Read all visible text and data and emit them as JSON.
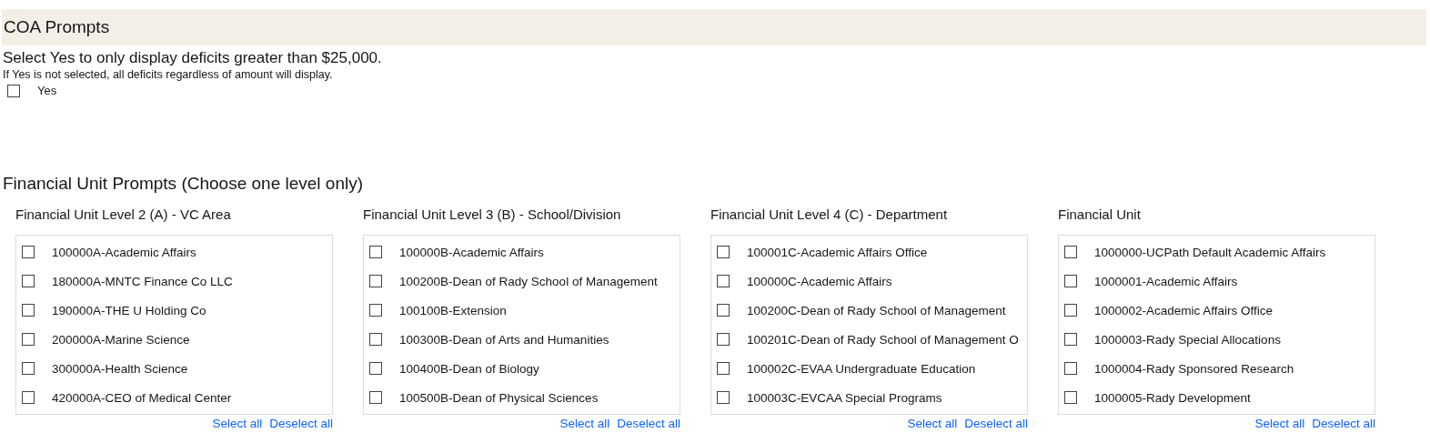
{
  "section_title": "COA Prompts",
  "deficit_prompt": {
    "heading": "Select Yes to only display deficits greater than $25,000.",
    "note": "If Yes is not selected, all deficits regardless of amount will display.",
    "option": {
      "label": "Yes",
      "checked": false
    }
  },
  "financial_unit_title": "Financial Unit Prompts (Choose one level only)",
  "lists": [
    {
      "label": "Financial Unit Level 2 (A) - VC Area",
      "items": [
        {
          "label": "100000A-Academic Affairs",
          "checked": false
        },
        {
          "label": "180000A-MNTC Finance Co LLC",
          "checked": false
        },
        {
          "label": "190000A-THE U Holding Co",
          "checked": false
        },
        {
          "label": "200000A-Marine Science",
          "checked": false
        },
        {
          "label": "300000A-Health Science",
          "checked": false
        },
        {
          "label": "420000A-CEO of Medical Center",
          "checked": false
        }
      ],
      "select_all": "Select all",
      "deselect_all": "Deselect all"
    },
    {
      "label": "Financial Unit Level 3 (B) - School/Division",
      "items": [
        {
          "label": "100000B-Academic Affairs",
          "checked": false
        },
        {
          "label": "100200B-Dean of Rady School of Management",
          "checked": false
        },
        {
          "label": "100100B-Extension",
          "checked": false
        },
        {
          "label": "100300B-Dean of Arts and Humanities",
          "checked": false
        },
        {
          "label": "100400B-Dean of Biology",
          "checked": false
        },
        {
          "label": "100500B-Dean of Physical Sciences",
          "checked": false
        }
      ],
      "select_all": "Select all",
      "deselect_all": "Deselect all"
    },
    {
      "label": "Financial Unit Level 4 (C) - Department",
      "items": [
        {
          "label": "100001C-Academic Affairs Office",
          "checked": false
        },
        {
          "label": "100000C-Academic Affairs",
          "checked": false
        },
        {
          "label": "100200C-Dean of Rady School of Management",
          "checked": false
        },
        {
          "label": "100201C-Dean of Rady School of Management O",
          "checked": false
        },
        {
          "label": "100002C-EVAA Undergraduate Education",
          "checked": false
        },
        {
          "label": "100003C-EVCAA Special Programs",
          "checked": false
        }
      ],
      "select_all": "Select all",
      "deselect_all": "Deselect all"
    },
    {
      "label": "Financial Unit",
      "items": [
        {
          "label": "1000000-UCPath Default Academic Affairs",
          "checked": false
        },
        {
          "label": "1000001-Academic Affairs",
          "checked": false
        },
        {
          "label": "1000002-Academic Affairs Office",
          "checked": false
        },
        {
          "label": "1000003-Rady Special Allocations",
          "checked": false
        },
        {
          "label": "1000004-Rady Sponsored Research",
          "checked": false
        },
        {
          "label": "1000005-Rady Development",
          "checked": false
        }
      ],
      "select_all": "Select all",
      "deselect_all": "Deselect all"
    }
  ]
}
